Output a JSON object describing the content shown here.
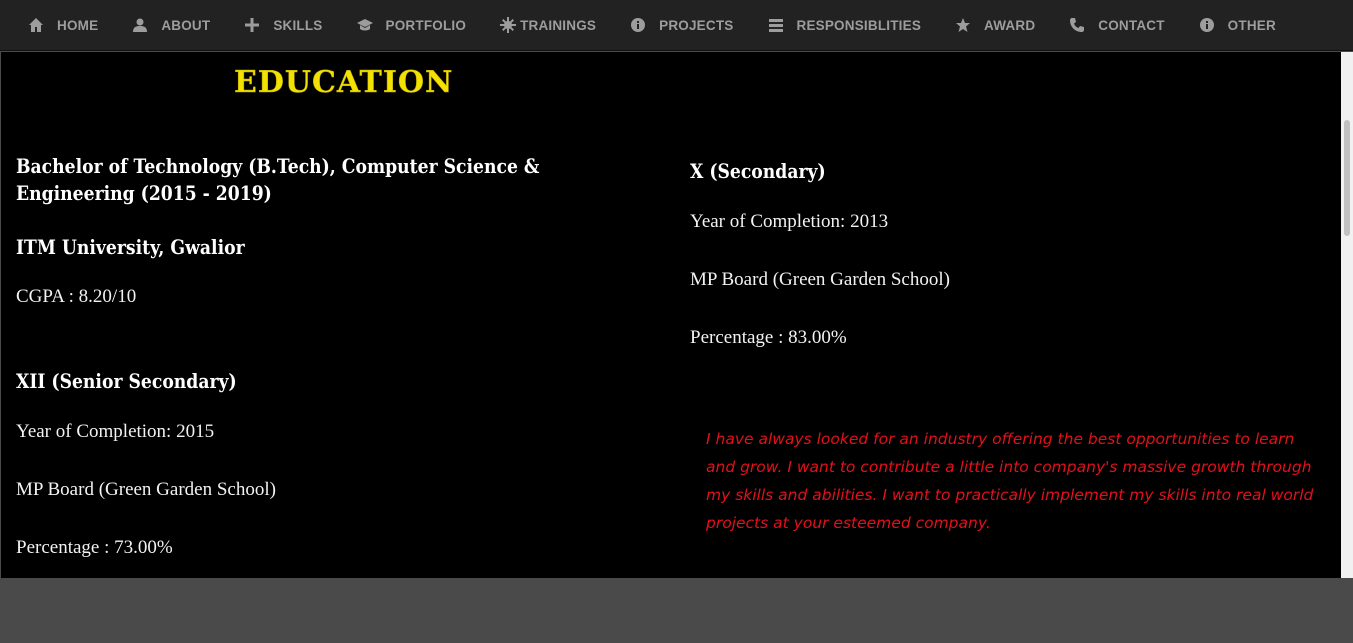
{
  "nav": {
    "items": [
      {
        "label": "HOME",
        "icon": "home-icon"
      },
      {
        "label": "ABOUT",
        "icon": "user-icon"
      },
      {
        "label": "SKILLS",
        "icon": "plus-icon"
      },
      {
        "label": "PORTFOLIO",
        "icon": "graduation-cap-icon"
      },
      {
        "label": "TRAININGS",
        "icon": "asterisk-icon"
      },
      {
        "label": "PROJECTS",
        "icon": "info-icon"
      },
      {
        "label": "RESPONSIBLITIES",
        "icon": "list-icon"
      },
      {
        "label": "AWARD",
        "icon": "star-icon"
      },
      {
        "label": "CONTACT",
        "icon": "phone-icon"
      },
      {
        "label": "OTHER",
        "icon": "info-icon"
      }
    ]
  },
  "education": {
    "title": "EDUCATION",
    "btech": {
      "heading": "Bachelor of Technology (B.Tech), Computer Science & Engineering (2015 - 2019)",
      "university": "ITM University, Gwalior",
      "cgpa": "CGPA : 8.20/10"
    },
    "xii": {
      "heading": "XII (Senior Secondary)",
      "year": "Year of Completion: 2015",
      "board": "MP Board (Green Garden School)",
      "percentage": "Percentage : 73.00%"
    },
    "x": {
      "heading": "X (Secondary)",
      "year": "Year of Completion: 2013",
      "board": "MP Board (Green Garden School)",
      "percentage": "Percentage : 83.00%"
    },
    "quote": "I have always looked for an industry offering the best opportunities to learn and grow. I want to contribute a little into company's massive growth through my skills and abilities. I want to practically implement my skills into real world projects at your esteemed company."
  },
  "colors": {
    "nav_bg": "#222222",
    "nav_text": "#9d9d9d",
    "title": "#f3e200",
    "quote": "#e3101a",
    "page_bg": "#4a4a4a"
  }
}
